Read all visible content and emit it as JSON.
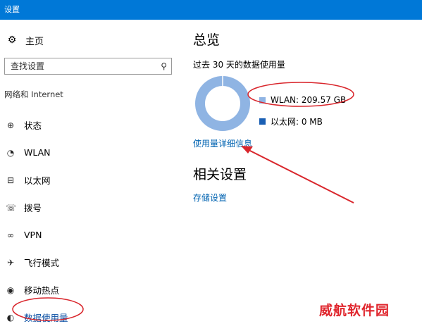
{
  "window": {
    "title": "设置"
  },
  "sidebar": {
    "home": {
      "icon": "gear-icon",
      "label": "主页"
    },
    "search": {
      "placeholder": "查找设置",
      "icon": "search-icon"
    },
    "group_title": "网络和 Internet",
    "items": [
      {
        "icon": "globe-icon",
        "label": "状态"
      },
      {
        "icon": "wifi-icon",
        "label": "WLAN"
      },
      {
        "icon": "ethernet-icon",
        "label": "以太网"
      },
      {
        "icon": "dialup-icon",
        "label": "拨号"
      },
      {
        "icon": "vpn-icon",
        "label": "VPN"
      },
      {
        "icon": "airplane-icon",
        "label": "飞行模式"
      },
      {
        "icon": "hotspot-icon",
        "label": "移动热点"
      },
      {
        "icon": "data-usage-icon",
        "label": "数据使用量",
        "active": true
      }
    ]
  },
  "main": {
    "title": "总览",
    "subtitle": "过去 30 天的数据使用量",
    "usage": [
      {
        "label": "WLAN: 209.57 GB",
        "color": "#8fb4e3",
        "share": 1.0
      },
      {
        "label": "以太网: 0 MB",
        "color": "#1a5fb4",
        "share": 0.0
      }
    ],
    "details_link": "使用量详细信息",
    "related_title": "相关设置",
    "storage_link": "存储设置"
  },
  "annotations": {
    "color": "#d9262c"
  },
  "watermark": "威航软件园"
}
